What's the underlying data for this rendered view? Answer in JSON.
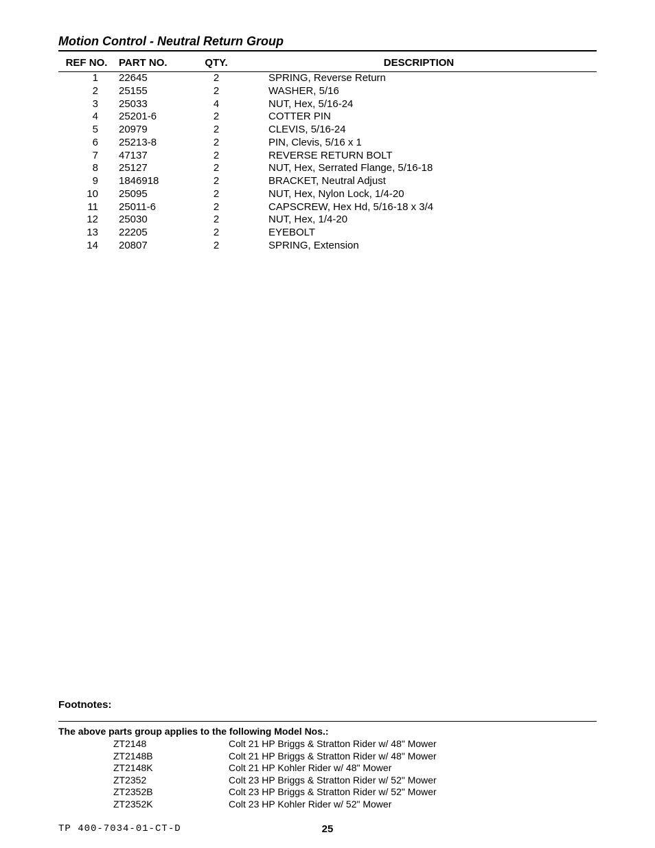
{
  "title": "Motion Control - Neutral Return Group",
  "headers": {
    "ref": "REF NO.",
    "part": "PART NO.",
    "qty": "QTY.",
    "desc": "DESCRIPTION"
  },
  "rows": [
    {
      "ref": "1",
      "part": "22645",
      "qty": "2",
      "desc": "SPRING, Reverse Return"
    },
    {
      "ref": "2",
      "part": "25155",
      "qty": "2",
      "desc": "WASHER, 5/16"
    },
    {
      "ref": "3",
      "part": "25033",
      "qty": "4",
      "desc": "NUT, Hex, 5/16-24"
    },
    {
      "ref": "4",
      "part": "25201-6",
      "qty": "2",
      "desc": "COTTER PIN"
    },
    {
      "ref": "5",
      "part": "20979",
      "qty": "2",
      "desc": "CLEVIS, 5/16-24"
    },
    {
      "ref": "6",
      "part": "25213-8",
      "qty": "2",
      "desc": "PIN, Clevis, 5/16 x 1"
    },
    {
      "ref": "7",
      "part": "47137",
      "qty": "2",
      "desc": "REVERSE RETURN BOLT"
    },
    {
      "ref": "8",
      "part": "25127",
      "qty": "2",
      "desc": "NUT, Hex, Serrated Flange, 5/16-18"
    },
    {
      "ref": "9",
      "part": "1846918",
      "qty": "2",
      "desc": "BRACKET, Neutral Adjust"
    },
    {
      "ref": "10",
      "part": "25095",
      "qty": "2",
      "desc": "NUT, Hex, Nylon Lock, 1/4-20"
    },
    {
      "ref": "11",
      "part": "25011-6",
      "qty": "2",
      "desc": "CAPSCREW, Hex Hd, 5/16-18 x 3/4"
    },
    {
      "ref": "12",
      "part": "25030",
      "qty": "2",
      "desc": "NUT, Hex, 1/4-20"
    },
    {
      "ref": "13",
      "part": "22205",
      "qty": "2",
      "desc": "EYEBOLT"
    },
    {
      "ref": "14",
      "part": "20807",
      "qty": "2",
      "desc": "SPRING, Extension"
    }
  ],
  "footnotes_label": "Footnotes:",
  "models_caption": "The above parts group applies to the following Model Nos.:",
  "models": [
    {
      "no": "ZT2148",
      "desc": "Colt 21 HP Briggs & Stratton Rider w/ 48\" Mower"
    },
    {
      "no": "ZT2148B",
      "desc": "Colt 21 HP Briggs & Stratton Rider w/ 48\" Mower"
    },
    {
      "no": "ZT2148K",
      "desc": "Colt 21 HP Kohler Rider w/ 48\" Mower"
    },
    {
      "no": "ZT2352",
      "desc": "Colt 23 HP Briggs & Stratton Rider w/ 52\" Mower"
    },
    {
      "no": "ZT2352B",
      "desc": "Colt 23 HP Briggs & Stratton Rider w/ 52\" Mower"
    },
    {
      "no": "ZT2352K",
      "desc": "Colt 23 HP Kohler Rider w/ 52\" Mower"
    }
  ],
  "doc_ref": "TP 400-7034-01-CT-D",
  "page_number": "25"
}
